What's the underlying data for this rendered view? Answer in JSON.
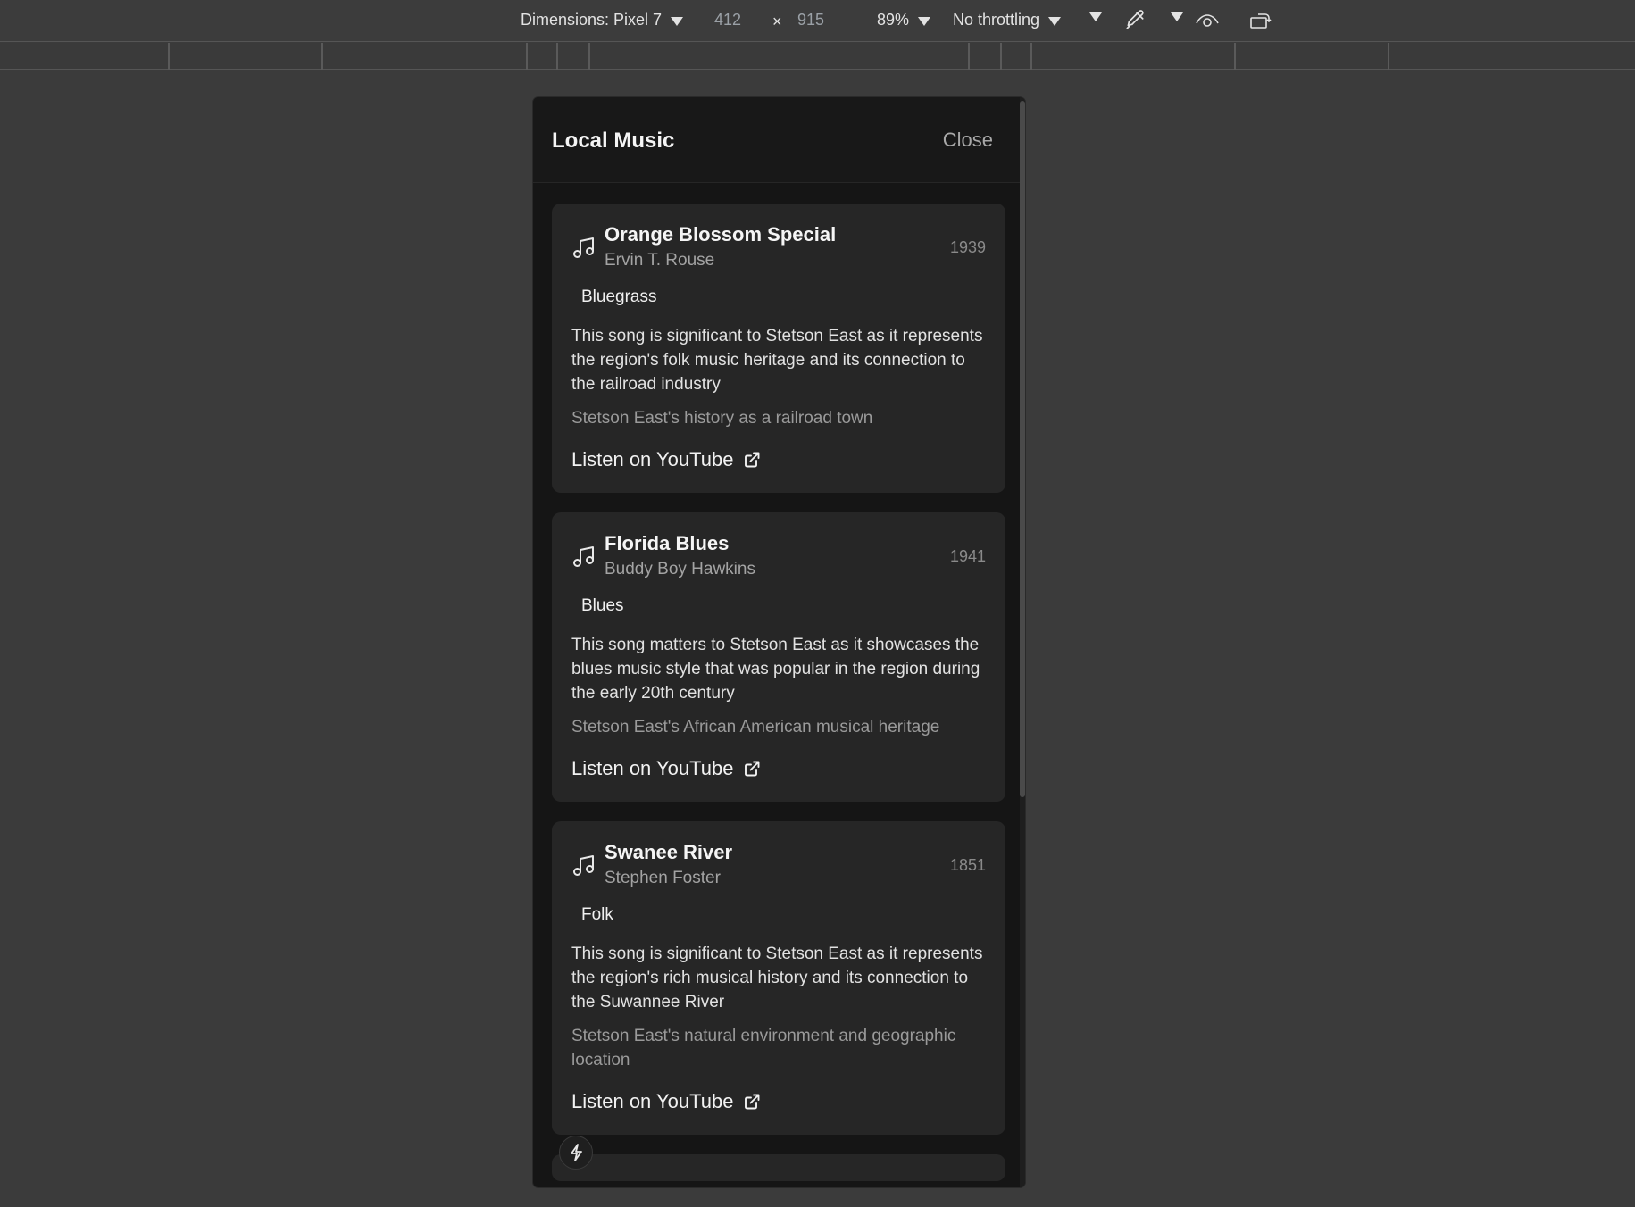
{
  "devtools": {
    "dimensions_label": "Dimensions: Pixel 7",
    "width_value": "412",
    "times": "×",
    "height_value": "915",
    "zoom": "89%",
    "throttling": "No throttling"
  },
  "panel": {
    "title": "Local Music",
    "close_label": "Close"
  },
  "songs": [
    {
      "title": "Orange Blossom Special",
      "artist": "Ervin T. Rouse",
      "year": "1939",
      "genre": "Bluegrass",
      "significance": "This song is significant to Stetson East as it represents the region's folk music heritage and its connection to the railroad industry",
      "context": "Stetson East's history as a railroad town",
      "link_label": "Listen on YouTube"
    },
    {
      "title": "Florida Blues",
      "artist": "Buddy Boy Hawkins",
      "year": "1941",
      "genre": "Blues",
      "significance": "This song matters to Stetson East as it showcases the blues music style that was popular in the region during the early 20th century",
      "context": "Stetson East's African American musical heritage",
      "link_label": "Listen on YouTube"
    },
    {
      "title": "Swanee River",
      "artist": "Stephen Foster",
      "year": "1851",
      "genre": "Folk",
      "significance": "This song is significant to Stetson East as it represents the region's rich musical history and its connection to the Suwannee River",
      "context": "Stetson East's natural environment and geographic location",
      "link_label": "Listen on YouTube"
    }
  ],
  "icons": {
    "song": "music-note-icon",
    "link": "external-link-icon",
    "fab": "lightning-icon"
  },
  "colors": {
    "background": "#3b3b3b",
    "panel": "#151515",
    "card": "#262626",
    "text": "#f5f5f5",
    "muted": "#9a9a9a"
  }
}
